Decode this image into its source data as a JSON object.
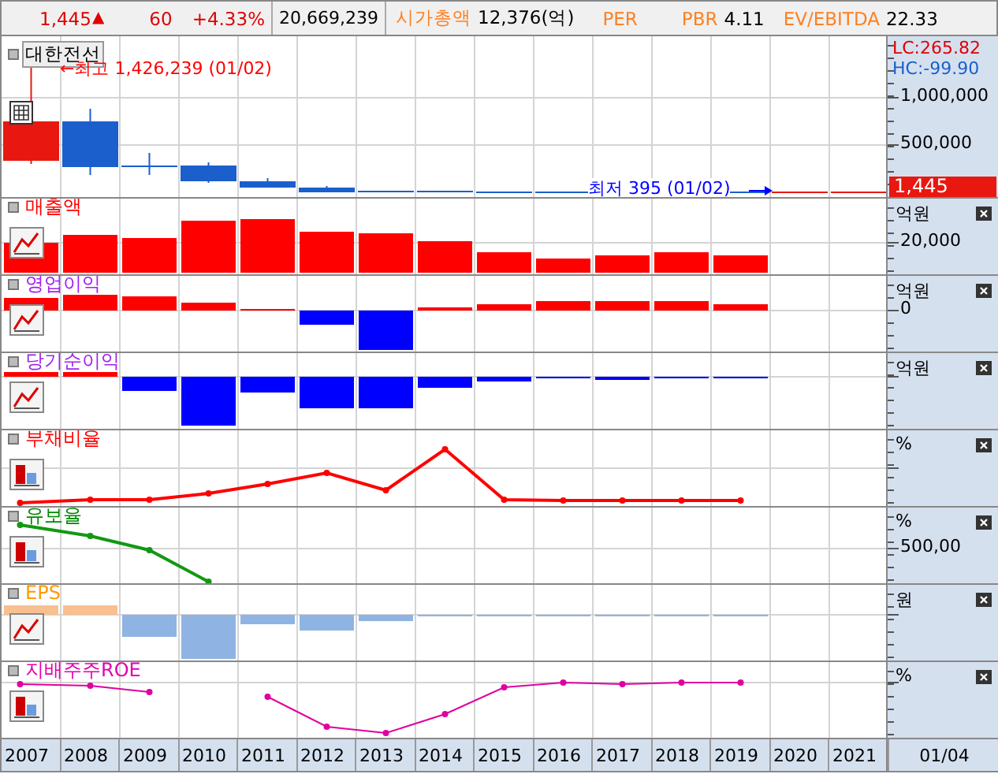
{
  "quote": {
    "price": "1,445",
    "direction": "▲",
    "change": "60",
    "change_rate": "+4.33%",
    "volume": "20,669,239",
    "market_cap_label": "시가총액",
    "market_cap": "12,376(억)",
    "per_label": "PER",
    "pbr_label": "PBR",
    "pbr": "4.11",
    "ev_ebitda_label": "EV/EBITDA",
    "ev_ebitda": "22.33"
  },
  "price_panel": {
    "name": "대한전선",
    "high_note": "←최고 1,426,239 (01/02)",
    "low_note": "최저 395 (01/02)",
    "lc": "LC:265.82",
    "hc": "HC:-99.90",
    "ticks": [
      "1,000,000",
      "500,000"
    ],
    "current": "1,445"
  },
  "panels": [
    {
      "name": "매출액",
      "color": "#ff0000",
      "unit": "억원",
      "kind": "bars",
      "ticks": [
        "20,000"
      ]
    },
    {
      "name": "영업이익",
      "color": "#a020f0",
      "unit": "억원",
      "kind": "bars",
      "ticks": [
        "0"
      ]
    },
    {
      "name": "당기순이익",
      "color": "#a020f0",
      "unit": "억원",
      "kind": "bars"
    },
    {
      "name": "부채비율",
      "color": "#ff0000",
      "unit": "%",
      "kind": "line"
    },
    {
      "name": "유보율",
      "color": "#008800",
      "unit": "%",
      "kind": "line",
      "ticks": [
        "500,00"
      ]
    },
    {
      "name": "EPS",
      "color": "#ff9900",
      "unit": "원",
      "kind": "bars"
    },
    {
      "name": "지배주주ROE",
      "color": "#e000b0",
      "unit": "%",
      "kind": "line"
    }
  ],
  "x_axis": {
    "years": [
      "2007",
      "2008",
      "2009",
      "2010",
      "2011",
      "2012",
      "2013",
      "2014",
      "2015",
      "2016",
      "2017",
      "2018",
      "2019",
      "2020",
      "2021"
    ],
    "date": "01/04"
  }
}
